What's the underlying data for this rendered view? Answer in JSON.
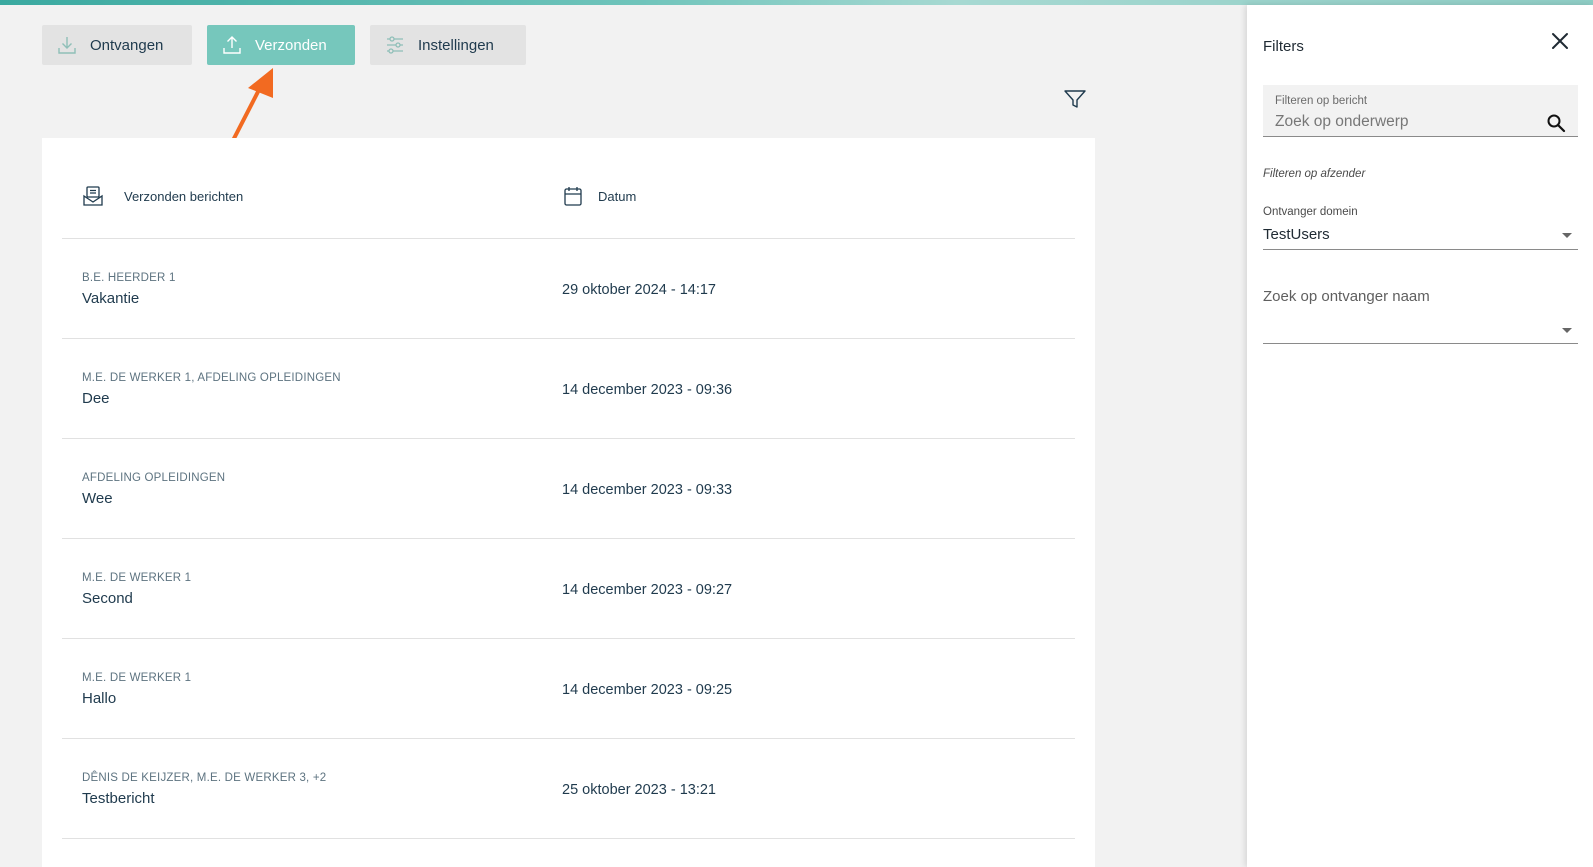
{
  "tabs": [
    {
      "label": "Ontvangen",
      "icon": "download-icon",
      "active": false
    },
    {
      "label": "Verzonden",
      "icon": "upload-icon",
      "active": true
    },
    {
      "label": "Instellingen",
      "icon": "sliders-icon",
      "active": false
    }
  ],
  "list": {
    "header_messages": "Verzonden berichten",
    "header_date": "Datum",
    "rows": [
      {
        "sender": "B.E. HEERDER 1",
        "subject": "Vakantie",
        "date": "29 oktober 2024 - 14:17"
      },
      {
        "sender": "M.E. DE WERKER 1, AFDELING OPLEIDINGEN",
        "subject": "Dee",
        "date": "14 december 2023 - 09:36"
      },
      {
        "sender": "AFDELING OPLEIDINGEN",
        "subject": "Wee",
        "date": "14 december 2023 - 09:33"
      },
      {
        "sender": "M.E. DE WERKER 1",
        "subject": "Second",
        "date": "14 december 2023 - 09:27"
      },
      {
        "sender": "M.E. DE WERKER 1",
        "subject": "Hallo",
        "date": "14 december 2023 - 09:25"
      },
      {
        "sender": "DÊNIS DE KEIJZER, M.E. DE WERKER 3, +2",
        "subject": "Testbericht",
        "date": "25 oktober 2023 - 13:21"
      }
    ]
  },
  "filters": {
    "title": "Filters",
    "search_label": "Filteren op bericht",
    "search_placeholder": "Zoek op onderwerp",
    "sender_section": "Filteren op afzender",
    "domain_label": "Ontvanger domein",
    "domain_value": "TestUsers",
    "name_placeholder": "Zoek op ontvanger naam"
  },
  "colors": {
    "accent": "#76c7bc",
    "arrow": "#f26a21",
    "text": "#1f3a4d"
  }
}
